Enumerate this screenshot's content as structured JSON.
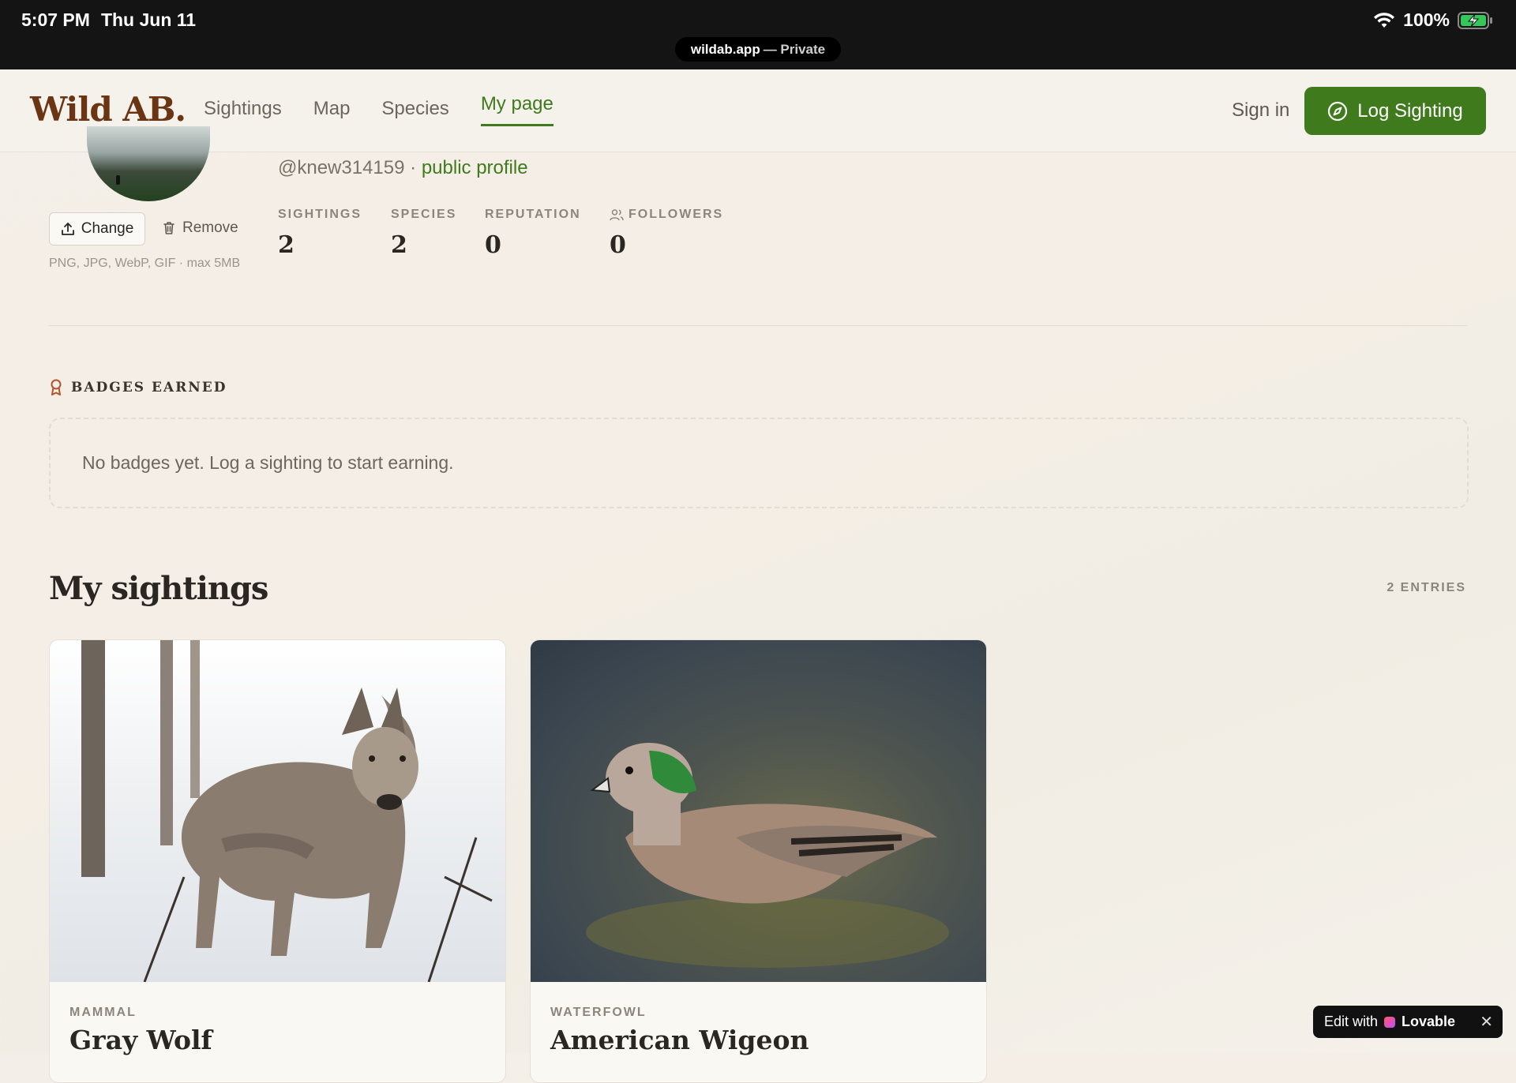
{
  "status_bar": {
    "time": "5:07 PM",
    "date": "Thu Jun 11",
    "battery": "100%",
    "url_host": "wildab.app",
    "url_suffix": "— Private"
  },
  "nav": {
    "logo": "Wild AB.",
    "links": [
      "Sightings",
      "Map",
      "Species",
      "My page"
    ],
    "active": "My page",
    "sign_in": "Sign in",
    "log_sighting": "Log Sighting",
    "accent": "#3f7a1d",
    "logo_color": "#6b3514"
  },
  "profile": {
    "change": "Change",
    "remove": "Remove",
    "file_hint": "PNG, JPG, WebP, GIF · max 5MB",
    "handle": "@knew314159 · ",
    "public_profile": "public profile",
    "stats": {
      "sightings_label": "SIGHTINGS",
      "sightings": "2",
      "species_label": "SPECIES",
      "species": "2",
      "reputation_label": "REPUTATION",
      "reputation": "0",
      "followers_label": "FOLLOWERS",
      "followers": "0"
    }
  },
  "badges": {
    "title": "BADGES EARNED",
    "empty": "No badges yet. Log a sighting to start earning."
  },
  "sightings": {
    "title": "My sightings",
    "count": "2 ENTRIES",
    "cards": [
      {
        "category": "MAMMAL",
        "name": "Gray Wolf"
      },
      {
        "category": "WATERFOWL",
        "name": "American Wigeon"
      }
    ]
  },
  "lovable": {
    "prefix": "Edit with",
    "brand": "Lovable",
    "close": "✕"
  }
}
